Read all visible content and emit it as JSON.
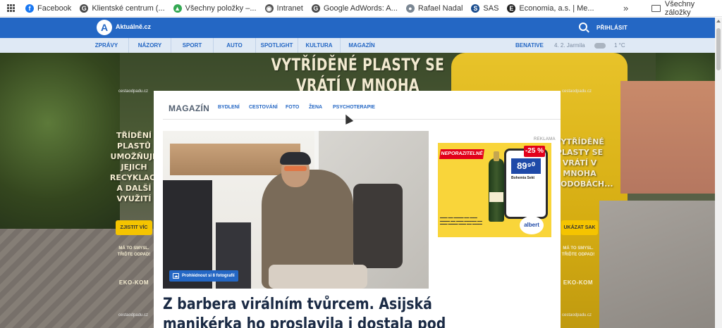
{
  "bookmarks": {
    "items": [
      {
        "label": "Facebook",
        "icon": "facebook-icon",
        "color": "#1877f2",
        "glyph": "f"
      },
      {
        "label": "Klientské centrum (...",
        "icon": "google-icon",
        "color": "#4a4a4a",
        "glyph": "G"
      },
      {
        "label": "Všechny položky –...",
        "icon": "drive-icon",
        "color": "#34a853",
        "glyph": "▲"
      },
      {
        "label": "Intranet",
        "icon": "globe-icon",
        "color": "#555555",
        "glyph": "◉"
      },
      {
        "label": "Google AdWords: A...",
        "icon": "google-icon",
        "color": "#4a4a4a",
        "glyph": "G"
      },
      {
        "label": "Rafael Nadal",
        "icon": "person-icon",
        "color": "#7b8793",
        "glyph": "●"
      },
      {
        "label": "SAS",
        "icon": "sas-icon",
        "color": "#1a4d8f",
        "glyph": "S"
      },
      {
        "label": "Economia, a.s. | Me...",
        "icon": "economia-icon",
        "color": "#222222",
        "glyph": "E"
      }
    ],
    "more": "»",
    "all_bookmarks": "Všechny záložky"
  },
  "header": {
    "logo_letter": "A",
    "logo_text": "Aktuálně.cz",
    "login": "PŘIHLÁSIT"
  },
  "nav": {
    "sections": [
      "ZPRÁVY",
      "NÁZORY",
      "SPORT",
      "AUTO",
      "SPOTLIGHT",
      "KULTURA",
      "MAGAZÍN"
    ],
    "location": "BENATIVE",
    "date": "4. 2. Jarmila",
    "weather_icon": "cloud-icon",
    "temperature": "1 °C"
  },
  "background_ad": {
    "headline": "VYTŘÍDĚNÉ PLASTY SE VRÁTÍ V MNOHA PODOBÁCH",
    "source": "cestaodpadu.cz",
    "left": {
      "text_lines": [
        "TŘÍDĚNÍ",
        "PLASTŮ",
        "UMOŽŇUJE",
        "JEJICH",
        "RECYKLACI",
        "A DALŠÍ",
        "VYUŽITÍ"
      ],
      "cta": "ZJISTIT VÍC"
    },
    "right": {
      "text_lines": [
        "VYTŘÍDĚNÉ",
        "PLASTY SE",
        "VRÁTÍ V",
        "MNOHA",
        "PODOBÁCH..."
      ],
      "cta": "UKÁZAT SAK"
    },
    "tagline": [
      "MÁ TO SMYSL.",
      "TŘIĎTE ODPAD!"
    ],
    "brand": "EKO-KOM"
  },
  "magazine": {
    "title": "MAGAZÍN",
    "links": [
      "BYDLENÍ",
      "CESTOVÁNÍ",
      "FOTO",
      "ŽENA",
      "PSYCHOTERAPIE"
    ],
    "photo_badge": "Prohlédnout si 8 fotografií",
    "ad_label": "REKLAMA",
    "article_title_line1": "Z barbera virálním tvůrcem. Asijská",
    "article_title_line2": "manikérka ho proslavila i dostala pod"
  },
  "promo": {
    "ribbon": "NEPORAZITELNÉ",
    "discount": "-25 %",
    "price": "89⁹⁰",
    "product": "Bohemia Sekt",
    "brand": "albert"
  }
}
